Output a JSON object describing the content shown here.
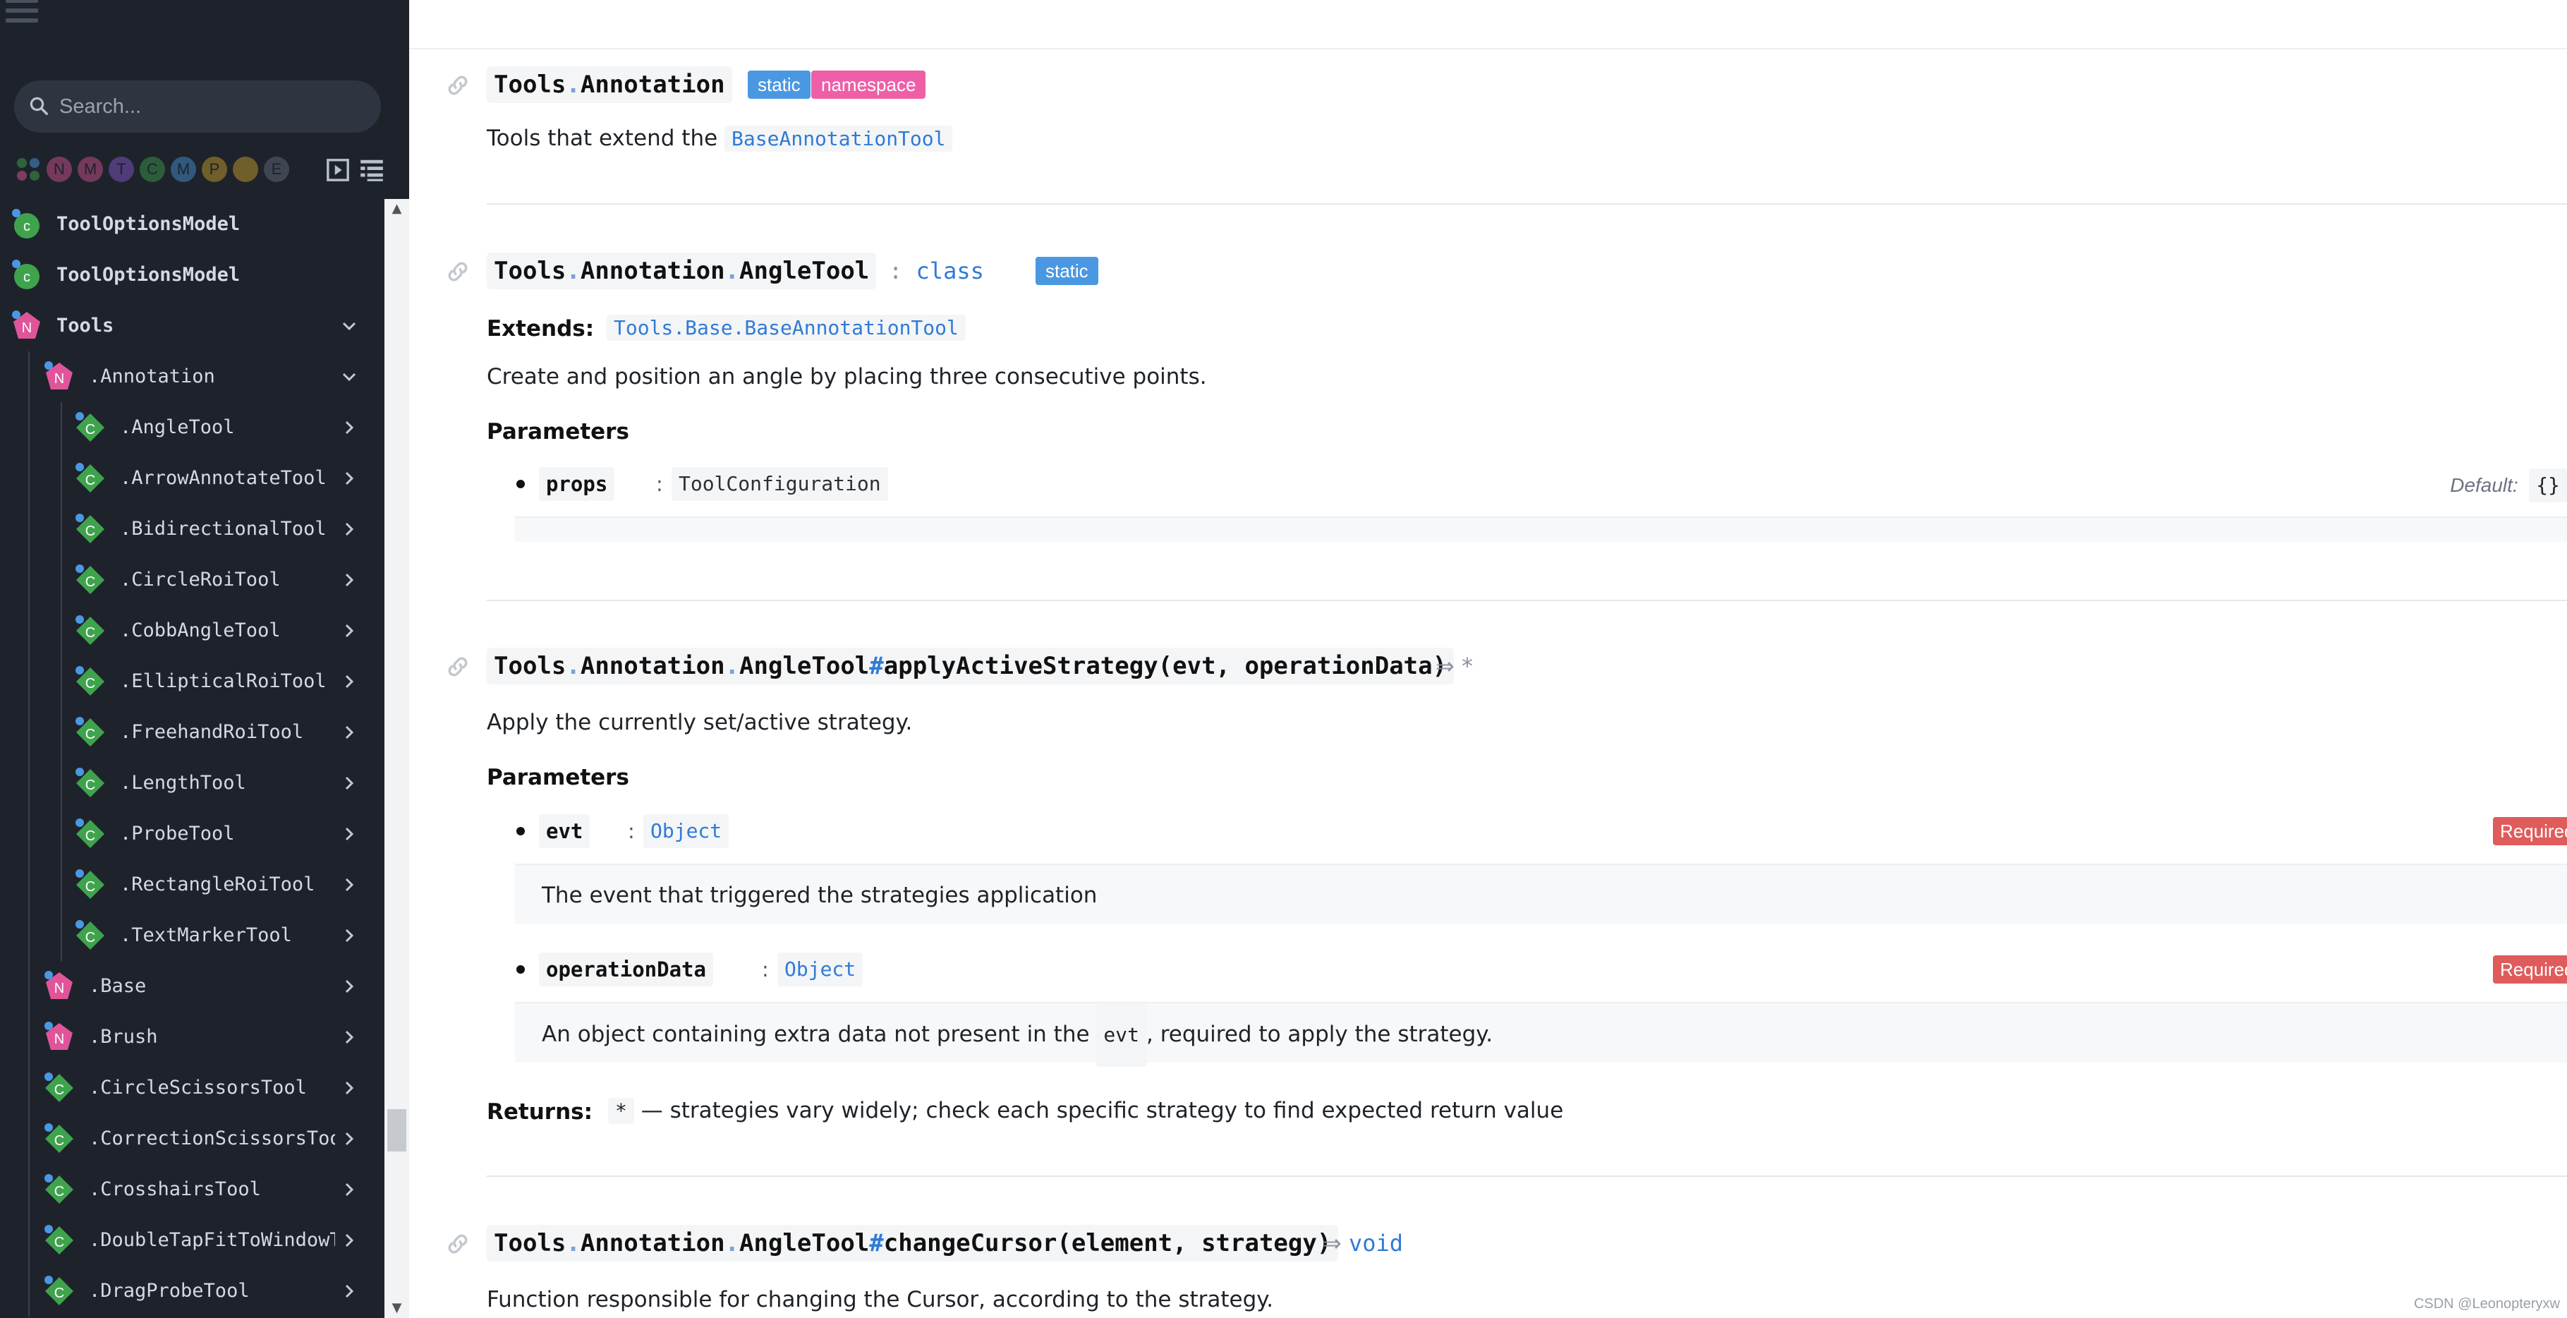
{
  "sidebar": {
    "search_placeholder": "Search...",
    "filters": [
      {
        "letter": "",
        "name": "all",
        "color": "#3fa34d"
      },
      {
        "letter": "N",
        "name": "namespace",
        "color": "#e0559a"
      },
      {
        "letter": "M",
        "name": "module",
        "color": "#e0559a"
      },
      {
        "letter": "T",
        "name": "typedef",
        "color": "#8c5bd6"
      },
      {
        "letter": "C",
        "name": "class",
        "color": "#3fa34d"
      },
      {
        "letter": "M",
        "name": "mixin",
        "color": "#4a98e2"
      },
      {
        "letter": "P",
        "name": "property",
        "color": "#d4a72c"
      },
      {
        "letter": "",
        "name": "event",
        "color": "#d4a72c"
      },
      {
        "letter": "E",
        "name": "external",
        "color": "#6b7280"
      }
    ],
    "items": [
      {
        "label": "ToolOptionsModel",
        "kind": "C",
        "depth": 0,
        "chevron": ""
      },
      {
        "label": "ToolOptionsModel",
        "kind": "C",
        "depth": 0,
        "chevron": ""
      },
      {
        "label": "Tools",
        "kind": "N",
        "depth": 0,
        "chevron": "down"
      },
      {
        "label": ".Annotation",
        "kind": "N",
        "depth": 1,
        "chevron": "down"
      },
      {
        "label": ".AngleTool",
        "kind": "C",
        "depth": 2,
        "chevron": "right"
      },
      {
        "label": ".ArrowAnnotateTool",
        "kind": "C",
        "depth": 2,
        "chevron": "right"
      },
      {
        "label": ".BidirectionalTool",
        "kind": "C",
        "depth": 2,
        "chevron": "right"
      },
      {
        "label": ".CircleRoiTool",
        "kind": "C",
        "depth": 2,
        "chevron": "right"
      },
      {
        "label": ".CobbAngleTool",
        "kind": "C",
        "depth": 2,
        "chevron": "right"
      },
      {
        "label": ".EllipticalRoiTool",
        "kind": "C",
        "depth": 2,
        "chevron": "right"
      },
      {
        "label": ".FreehandRoiTool",
        "kind": "C",
        "depth": 2,
        "chevron": "right"
      },
      {
        "label": ".LengthTool",
        "kind": "C",
        "depth": 2,
        "chevron": "right"
      },
      {
        "label": ".ProbeTool",
        "kind": "C",
        "depth": 2,
        "chevron": "right"
      },
      {
        "label": ".RectangleRoiTool",
        "kind": "C",
        "depth": 2,
        "chevron": "right"
      },
      {
        "label": ".TextMarkerTool",
        "kind": "C",
        "depth": 2,
        "chevron": "right"
      },
      {
        "label": ".Base",
        "kind": "N",
        "depth": 1,
        "chevron": "right"
      },
      {
        "label": ".Brush",
        "kind": "N",
        "depth": 1,
        "chevron": "right"
      },
      {
        "label": ".CircleScissorsTool",
        "kind": "C",
        "depth": 1,
        "chevron": "right"
      },
      {
        "label": ".CorrectionScissorsTool",
        "kind": "C",
        "depth": 1,
        "chevron": "right"
      },
      {
        "label": ".CrosshairsTool",
        "kind": "C",
        "depth": 1,
        "chevron": "right"
      },
      {
        "label": ".DoubleTapFitToWindowTool",
        "kind": "C",
        "depth": 1,
        "chevron": "right"
      },
      {
        "label": ".DragProbeTool",
        "kind": "C",
        "depth": 1,
        "chevron": "right"
      }
    ]
  },
  "colors": {
    "namespace": "#e0559a",
    "class": "#3fa34d",
    "link": "#2f7bd6",
    "static": "#4a98e2",
    "required": "#e05b5b"
  },
  "main": {
    "s1": {
      "sig_a": "Tools",
      "sig_b": ".",
      "sig_c": "Annotation",
      "tag_static": "static",
      "tag_namespace": "namespace",
      "desc_prefix": "Tools that extend the ",
      "desc_code": "BaseAnnotationTool"
    },
    "s2": {
      "sig_a": "Tools",
      "sig_b": ".",
      "sig_c": "Annotation",
      "sig_d": ".",
      "sig_e": "AngleTool",
      "kind_sep": ":",
      "kind": "class",
      "tag_static": "static",
      "extends_label": "Extends:",
      "extends_value": "Tools.Base.BaseAnnotationTool",
      "desc": "Create and position an angle by placing three consecutive points.",
      "params_label": "Parameters",
      "p1_name": "props",
      "p1_colon": ":",
      "p1_type": "ToolConfiguration",
      "p1_default_label": "Default:",
      "p1_default_value": "{}"
    },
    "s3": {
      "sig_a": "Tools",
      "sig_b": ".",
      "sig_c": "Annotation",
      "sig_d": ".",
      "sig_e": "AngleTool",
      "sig_hash": "#",
      "sig_f": "applyActiveStrategy(evt, operationData)",
      "arrow": "⇒",
      "ret": "*",
      "desc": "Apply the currently set/active strategy.",
      "params_label": "Parameters",
      "p1_name": "evt",
      "p1_colon": ":",
      "p1_type": "Object",
      "p1_required": "Required",
      "p1_desc": "The event that triggered the strategies application",
      "p2_name": "operationData",
      "p2_colon": ":",
      "p2_type": "Object",
      "p2_required": "Required",
      "p2_desc_a": "An object containing extra data not present in the ",
      "p2_desc_code": "evt",
      "p2_desc_b": ", required to apply the strategy.",
      "returns_label": "Returns:",
      "returns_code": "*",
      "returns_dash": "—",
      "returns_text": "strategies vary widely; check each specific strategy to find expected return value"
    },
    "s4": {
      "sig_a": "Tools",
      "sig_b": ".",
      "sig_c": "Annotation",
      "sig_d": ".",
      "sig_e": "AngleTool",
      "sig_hash": "#",
      "sig_f": "changeCursor(element, strategy)",
      "arrow": "⇒",
      "ret": "void",
      "desc": "Function responsible for changing the Cursor, according to the strategy."
    }
  },
  "watermark": "CSDN @Leonopteryxw"
}
